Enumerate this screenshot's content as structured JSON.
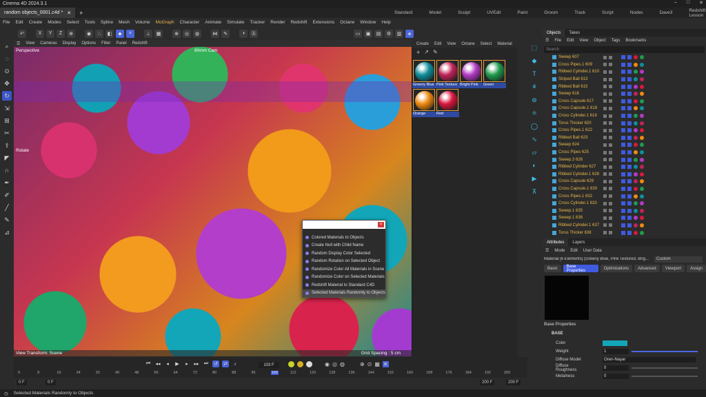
{
  "app": {
    "title": "Cinema 4D 2024.3.1"
  },
  "tabs": {
    "document": "random objects_0001.c4d *",
    "add": "+"
  },
  "layouts": [
    "Standard",
    "Model",
    "Sculpt",
    "UVEdit",
    "Paint",
    "Groom",
    "Track",
    "Script",
    "Nodes",
    "Dave3",
    "Redshift Lesson"
  ],
  "menu": [
    "File",
    "Edit",
    "Create",
    "Modes",
    "Select",
    "Tools",
    "Spline",
    "Mesh",
    "Volume",
    "MoGraph",
    "Character",
    "Animate",
    "Simulate",
    "Tracker",
    "Render",
    "Redshift",
    "Extensions",
    "Octane",
    "Window",
    "Help"
  ],
  "menu_active": "MoGraph",
  "toolbar": {
    "x": "X",
    "y": "Y",
    "z": "Z"
  },
  "viewport": {
    "menu": [
      "View",
      "Cameras",
      "Display",
      "Options",
      "Filter",
      "Panel",
      "Redshift"
    ],
    "label": "Perspective",
    "camera": "80mm Cam",
    "rotate_label": "Rotate",
    "transform": "View Transform: Scene",
    "grid": "Grid Spacing : 5 cm"
  },
  "popup": {
    "items": [
      "Colored Materials to Objects",
      "Create Null with Child Name",
      "Random Display Color Selected",
      "Random Rotation on Selected Object",
      "Randomize Color All Materials in Scene",
      "Randomize Color on Selected Materials",
      "Redshift Material to Standard C4D",
      "Selected Materials Randomly to Objects"
    ],
    "close": "×"
  },
  "materials": {
    "menu": [
      "Create",
      "Edit",
      "View",
      "Octane",
      "Select",
      "Material"
    ],
    "items": [
      {
        "name": "Greeny Blue",
        "color": "#0f8f9a"
      },
      {
        "name": "Pink Texture",
        "color": "#c0245a"
      },
      {
        "name": "Bright Pink",
        "color": "#b33bc4"
      },
      {
        "name": "Green",
        "color": "#1f9a4e"
      },
      {
        "name": "Orange",
        "color": "#ef8a10"
      },
      {
        "name": "Red",
        "color": "#d9183e"
      }
    ]
  },
  "objects": {
    "tabs": [
      "Objects",
      "Takes"
    ],
    "menu": [
      "File",
      "Edit",
      "View",
      "Object",
      "Tags",
      "Bookmarks"
    ],
    "search": "Search",
    "rows": [
      "Sweep 607",
      "Cross Pipes.1 609",
      "Ribbed Cylinder.1 610",
      "Striped Ball 613",
      "Ribbed Ball 615",
      "Sweep 616",
      "Cross Capsule 617",
      "Cross Capsule.1 618",
      "Cross Cylinder.1 619",
      "Torus Thicker 620",
      "Cross Pipes.1 622",
      "Ribbed Ball 623",
      "Sweep 624",
      "Cross Pipes 625",
      "Sweep.3 626",
      "Ribbed Cylinder 627",
      "Ribbed Cylinder.1 628",
      "Cross Capsule 629",
      "Cross Capsule.1 630",
      "Cross Pipes.1 632",
      "Cross Cylinder.1 633",
      "Sweep.1 635",
      "Sweep.1 636",
      "Ribbed Cylinder.1 637",
      "Torus Thicker 638"
    ],
    "tag_colors": [
      "#d9183e",
      "#ef8a10",
      "#1f9a4e",
      "#0f8f9a",
      "#b33bc4",
      "#c0245a"
    ]
  },
  "attributes": {
    "tabs": [
      "Attributes",
      "Layers"
    ],
    "menu": [
      "Mode",
      "Edit",
      "User Data"
    ],
    "title": "Material [6 Elements] (Greeny Blue, Pink Textured, Brig...",
    "mode": "Custom",
    "subtabs": [
      "Basic",
      "Base Properties",
      "Optimizations",
      "Advanced",
      "Viewport",
      "Assign"
    ],
    "subtab_active": "Base Properties",
    "section": "Base Properties",
    "group": "BASE",
    "props": [
      {
        "k": "Color",
        "v": ""
      },
      {
        "k": "Weight",
        "v": "1"
      },
      {
        "k": "Diffuse Model",
        "v": "Oren-Nayar"
      },
      {
        "k": "Diffuse Roughness",
        "v": "0"
      },
      {
        "k": "Metalness",
        "v": "0"
      }
    ],
    "color_value": "#12a6b8",
    "weight_fraction": 1,
    "roughness_fraction": 0,
    "metalness_fraction": 0
  },
  "timeline": {
    "frame": "103 F",
    "ticks": [
      "0",
      "8",
      "16",
      "24",
      "32",
      "40",
      "48",
      "56",
      "64",
      "72",
      "80",
      "88",
      "96",
      "103",
      "112",
      "120",
      "128",
      "136",
      "144",
      "152",
      "160",
      "168",
      "176",
      "184",
      "192",
      "200"
    ],
    "start": "0 F",
    "start2": "0 F",
    "end": "200 F",
    "end2": "200 F"
  },
  "status": {
    "text": "Selected Materials Randomly to Objects"
  }
}
